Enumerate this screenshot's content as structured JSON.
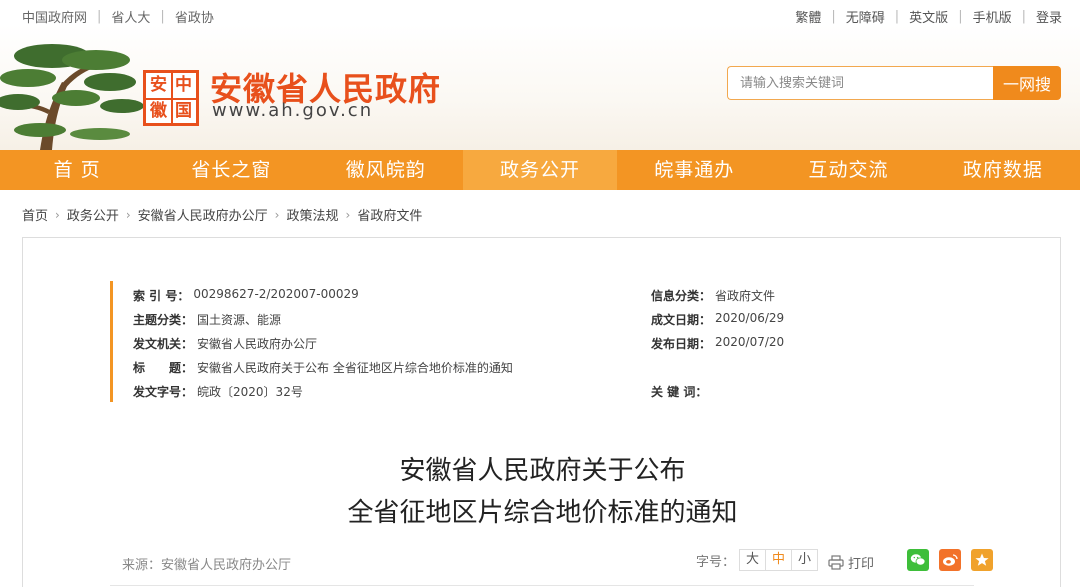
{
  "topbar": {
    "left_links": [
      "中国政府网",
      "省人大",
      "省政协"
    ],
    "right_links": [
      "繁體",
      "无障碍",
      "英文版",
      "手机版",
      "登录"
    ]
  },
  "header": {
    "seal_chars": [
      "安",
      "中",
      "徽",
      "国"
    ],
    "site_title": "安徽省人民政府",
    "site_url": "www.ah.gov.cn",
    "search_placeholder": "请输入搜索关键词",
    "search_button": "一网搜"
  },
  "nav": {
    "items": [
      "首 页",
      "省长之窗",
      "徽风皖韵",
      "政务公开",
      "皖事通办",
      "互动交流",
      "政府数据"
    ],
    "active_index": 3
  },
  "breadcrumb": [
    "首页",
    "政务公开",
    "安徽省人民政府办公厅",
    "政策法规",
    "省政府文件"
  ],
  "meta": {
    "index_label": "索 引 号：",
    "index_value": "00298627-2/202007-00029",
    "subject_label": "主题分类：",
    "subject_value": "国土资源、能源",
    "issuer_label": "发文机关：",
    "issuer_value": "安徽省人民政府办公厅",
    "title_label": "标　　题：",
    "title_value": "安徽省人民政府关于公布 全省征地区片综合地价标准的通知",
    "docno_label": "发文字号：",
    "docno_value": "皖政〔2020〕32号",
    "category_label": "信息分类：",
    "category_value": "省政府文件",
    "created_label": "成文日期：",
    "created_value": "2020/06/29",
    "published_label": "发布日期：",
    "published_value": "2020/07/20",
    "keywords_label": "关 键 词："
  },
  "document": {
    "title_line1": "安徽省人民政府关于公布",
    "title_line2": "全省征地区片综合地价标准的通知",
    "source": "来源：安徽省人民政府办公厅",
    "fontsize_label": "字号：",
    "fontsize_options": [
      "大",
      "中",
      "小"
    ],
    "fontsize_active": 1,
    "print_label": "打印"
  },
  "colors": {
    "brand_orange": "#f39523",
    "title_red": "#e8501c",
    "wechat_green": "#3ebe3a",
    "weibo_orange": "#f2722a",
    "favorite_orange": "#f0a22c"
  },
  "icons": [
    "pine-tree-logo",
    "printer-icon",
    "wechat-icon",
    "weibo-icon",
    "favorite-star-icon",
    "chevron-right-icon"
  ]
}
